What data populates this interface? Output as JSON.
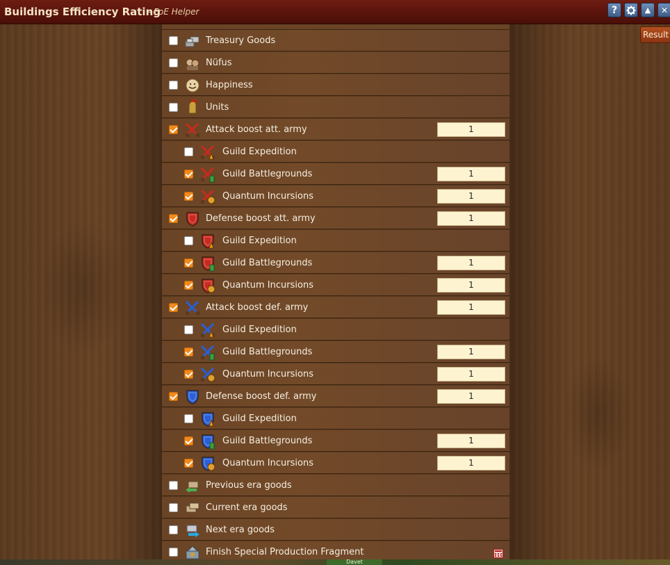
{
  "window": {
    "title": "Buildings Efficiency Rating",
    "subtitle": "- FoE Helper",
    "buttons": {
      "help": "?",
      "up": "▲",
      "close": "✕"
    },
    "result_label": "Result"
  },
  "colors": {
    "titlebar": "#5a140c",
    "checkbox_checked": "#f28a1a",
    "value_bg": "#fdf3d0"
  },
  "rows": [
    {
      "label": "Treasury Goods",
      "checked": false,
      "level": 0,
      "icon": "treasury-goods-icon"
    },
    {
      "label": "Nüfus",
      "checked": false,
      "level": 0,
      "icon": "population-icon"
    },
    {
      "label": "Happiness",
      "checked": false,
      "level": 0,
      "icon": "happiness-icon"
    },
    {
      "label": "Units",
      "checked": false,
      "level": 0,
      "icon": "units-icon"
    },
    {
      "label": "Attack boost att. army",
      "checked": true,
      "level": 0,
      "icon": "attack-att-icon",
      "value": "1"
    },
    {
      "label": "Guild Expedition",
      "checked": false,
      "level": 1,
      "icon": "attack-att-ge-icon"
    },
    {
      "label": "Guild Battlegrounds",
      "checked": true,
      "level": 1,
      "icon": "attack-att-gbg-icon",
      "value": "1"
    },
    {
      "label": "Quantum Incursions",
      "checked": true,
      "level": 1,
      "icon": "attack-att-qi-icon",
      "value": "1"
    },
    {
      "label": "Defense boost att. army",
      "checked": true,
      "level": 0,
      "icon": "defense-att-icon",
      "value": "1"
    },
    {
      "label": "Guild Expedition",
      "checked": false,
      "level": 1,
      "icon": "defense-att-ge-icon"
    },
    {
      "label": "Guild Battlegrounds",
      "checked": true,
      "level": 1,
      "icon": "defense-att-gbg-icon",
      "value": "1"
    },
    {
      "label": "Quantum Incursions",
      "checked": true,
      "level": 1,
      "icon": "defense-att-qi-icon",
      "value": "1"
    },
    {
      "label": "Attack boost def. army",
      "checked": true,
      "level": 0,
      "icon": "attack-def-icon",
      "value": "1"
    },
    {
      "label": "Guild Expedition",
      "checked": false,
      "level": 1,
      "icon": "attack-def-ge-icon"
    },
    {
      "label": "Guild Battlegrounds",
      "checked": true,
      "level": 1,
      "icon": "attack-def-gbg-icon",
      "value": "1"
    },
    {
      "label": "Quantum Incursions",
      "checked": true,
      "level": 1,
      "icon": "attack-def-qi-icon",
      "value": "1"
    },
    {
      "label": "Defense boost def. army",
      "checked": true,
      "level": 0,
      "icon": "defense-def-icon",
      "value": "1"
    },
    {
      "label": "Guild Expedition",
      "checked": false,
      "level": 1,
      "icon": "defense-def-ge-icon"
    },
    {
      "label": "Guild Battlegrounds",
      "checked": true,
      "level": 1,
      "icon": "defense-def-gbg-icon",
      "value": "1"
    },
    {
      "label": "Quantum Incursions",
      "checked": true,
      "level": 1,
      "icon": "defense-def-qi-icon",
      "value": "1"
    },
    {
      "label": "Previous era goods",
      "checked": false,
      "level": 0,
      "icon": "previous-era-goods-icon"
    },
    {
      "label": "Current era goods",
      "checked": false,
      "level": 0,
      "icon": "current-era-goods-icon"
    },
    {
      "label": "Next era goods",
      "checked": false,
      "level": 0,
      "icon": "next-era-goods-icon"
    },
    {
      "label": "Finish Special Production Fragment",
      "checked": false,
      "level": 0,
      "icon": "fsp-fragment-icon",
      "calc": true
    }
  ],
  "bottom_tab_label": "Davet"
}
